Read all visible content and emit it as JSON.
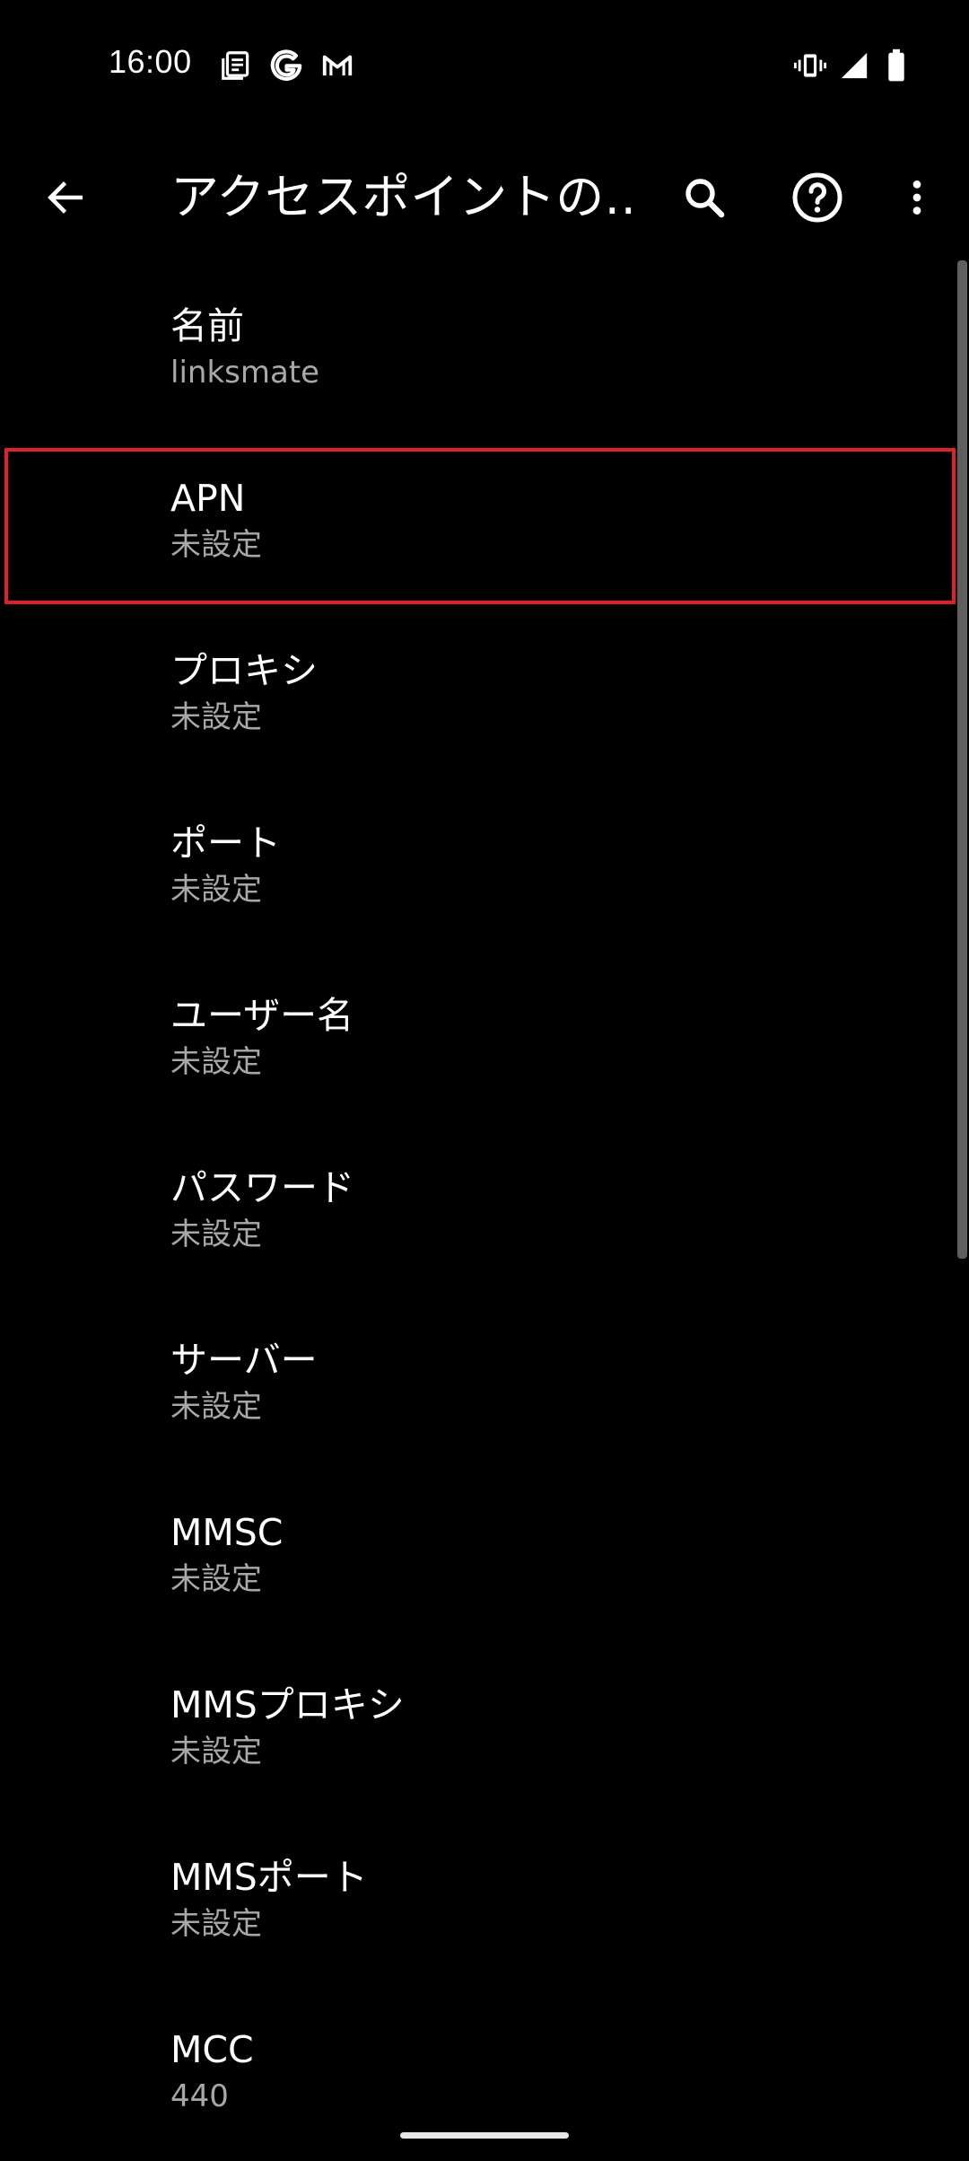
{
  "status_bar": {
    "time": "16:00",
    "notification_icons": [
      "news-icon",
      "google-icon",
      "gmail-icon"
    ],
    "system_icons": [
      "vibrate-icon",
      "signal-icon",
      "battery-icon"
    ]
  },
  "app_bar": {
    "title": "アクセスポイントの…",
    "back_icon": "back-arrow-icon",
    "actions": [
      "search-icon",
      "help-icon",
      "more-vert-icon"
    ]
  },
  "preferences": [
    {
      "key": "name",
      "title": "名前",
      "summary": "linksmate"
    },
    {
      "key": "apn",
      "title": "APN",
      "summary": "未設定"
    },
    {
      "key": "proxy",
      "title": "プロキシ",
      "summary": "未設定"
    },
    {
      "key": "port",
      "title": "ポート",
      "summary": "未設定"
    },
    {
      "key": "username",
      "title": "ユーザー名",
      "summary": "未設定"
    },
    {
      "key": "password",
      "title": "パスワード",
      "summary": "未設定"
    },
    {
      "key": "server",
      "title": "サーバー",
      "summary": "未設定"
    },
    {
      "key": "mmsc",
      "title": "MMSC",
      "summary": "未設定"
    },
    {
      "key": "mms-proxy",
      "title": "MMSプロキシ",
      "summary": "未設定"
    },
    {
      "key": "mms-port",
      "title": "MMSポート",
      "summary": "未設定"
    },
    {
      "key": "mcc",
      "title": "MCC",
      "summary": "440"
    }
  ],
  "colors": {
    "background": "#000000",
    "highlight_border": "#e0202a",
    "summary_text": "#a8a8a8"
  }
}
